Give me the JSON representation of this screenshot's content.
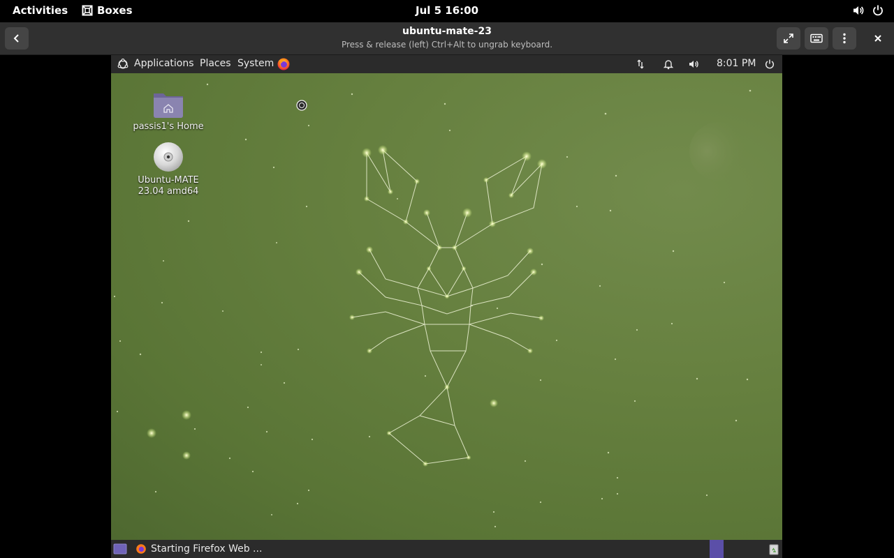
{
  "gnome": {
    "activities": "Activities",
    "app_name": "Boxes",
    "clock": "Jul 5  16:00"
  },
  "header": {
    "title": "ubuntu-mate-23",
    "subtitle": "Press & release (left) Ctrl+Alt to ungrab keyboard."
  },
  "vm": {
    "menus": [
      "Applications",
      "Places",
      "System"
    ],
    "time": "8:01 PM",
    "desktop_icons": [
      {
        "label": "passis1's Home",
        "icon": "home-folder-icon"
      },
      {
        "label": "Ubuntu-MATE 23.04 amd64",
        "icon": "cd-disc-icon"
      }
    ],
    "taskbar_item": "Starting Firefox Web ..."
  },
  "colors": {
    "desktop_green": "#5f7a3a",
    "panel": "#2b2b2b",
    "headerbar": "#303030",
    "workspace_accent": "#5b4fa8"
  }
}
